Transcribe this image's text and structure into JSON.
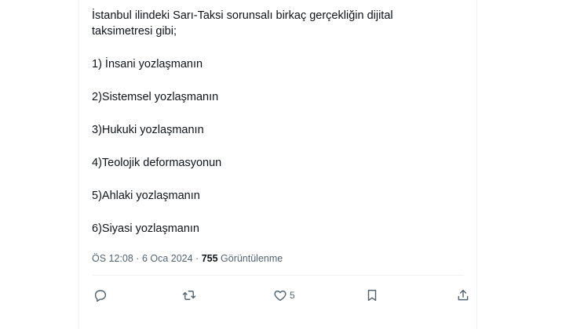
{
  "tweet": {
    "intro_line_1": "İstanbul ilindeki Sarı-Taksi sorunsalı birkaç gerçekliğin dijital",
    "intro_line_2": "taksimetresi gibi;",
    "items": [
      "1) İnsani yozlaşmanın",
      "2)Sistemsel yozlaşmanın",
      "3)Hukuki yozlaşmanın",
      "4)Teolojik deformasyonun",
      "5)Ahlaki yozlaşmanın",
      "6)Siyasi yozlaşmanın"
    ]
  },
  "meta": {
    "time": "ÖS 12:08",
    "separator": " · ",
    "date": "6 Oca 2024",
    "views_count": "755",
    "views_label": " Görüntülenme"
  },
  "actions": {
    "reply_icon": "reply-icon",
    "retweet_icon": "retweet-icon",
    "like_icon": "heart-icon",
    "like_count": "5",
    "bookmark_icon": "bookmark-icon",
    "share_icon": "share-icon"
  },
  "colors": {
    "text": "#0f1419",
    "secondary": "#536471",
    "border": "#eff3f4"
  }
}
